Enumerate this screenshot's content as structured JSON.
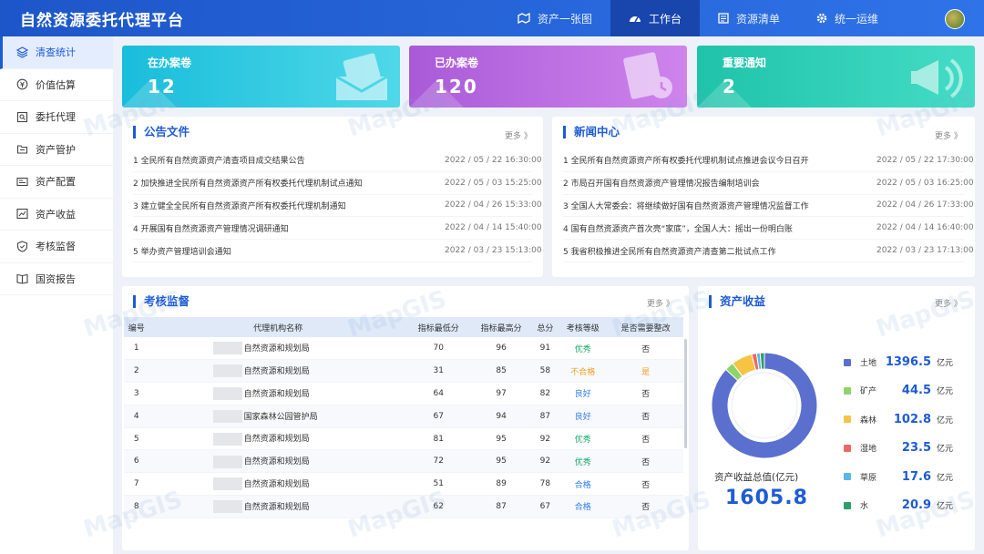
{
  "app": {
    "title": "自然资源委托代理平台"
  },
  "nav": [
    {
      "label": "资产一张图",
      "icon": "globe-map-icon"
    },
    {
      "label": "工作台",
      "icon": "dashboard-icon",
      "active": true
    },
    {
      "label": "资源清单",
      "icon": "list-icon"
    },
    {
      "label": "统一运维",
      "icon": "gear-icon"
    }
  ],
  "sidebar": [
    {
      "label": "清查统计",
      "icon": "layers-icon",
      "active": true
    },
    {
      "label": "价值估算",
      "icon": "coin-icon"
    },
    {
      "label": "委托代理",
      "icon": "document-search-icon"
    },
    {
      "label": "资产管护",
      "icon": "folder-icon"
    },
    {
      "label": "资产配置",
      "icon": "id-card-icon"
    },
    {
      "label": "资产收益",
      "icon": "line-chart-icon"
    },
    {
      "label": "考核监督",
      "icon": "shield-check-icon"
    },
    {
      "label": "国资报告",
      "icon": "book-icon"
    }
  ],
  "cards": [
    {
      "label": "在办案卷",
      "value": "12",
      "color": "#1cc2d9"
    },
    {
      "label": "已办案卷",
      "value": "120",
      "color": "#b86ddf"
    },
    {
      "label": "重要通知",
      "value": "2",
      "color": "#22c9b2"
    }
  ],
  "notices": {
    "title": "公告文件",
    "more": "更多 》",
    "items": [
      {
        "text": "1 全民所有自然资源资产清查项目成交结果公告",
        "date": "2022 / 05 / 22  16:30:00"
      },
      {
        "text": "2 加快推进全民所有自然资源资产所有权委托代理机制试点通知",
        "date": "2022 / 05 / 03  15:25:00"
      },
      {
        "text": "3 建立健全全民所有自然资源资产所有权委托代理机制通知",
        "date": "2022 / 04 / 26  15:33:00"
      },
      {
        "text": "4 开展国有自然资源资产管理情况调研通知",
        "date": "2022 / 04 / 14  15:40:00"
      },
      {
        "text": "5 举办资产管理培训会通知",
        "date": "2022 / 03 / 23  15:13:00"
      }
    ]
  },
  "news": {
    "title": "新闻中心",
    "more": "更多 》",
    "items": [
      {
        "text": "1 全民所有自然资源资产所有权委托代理机制试点推进会议今日召开",
        "date": "2022 / 05 / 22  17:30:00"
      },
      {
        "text": "2 市局召开国有自然资源资产管理情况报告编制培训会",
        "date": "2022 / 05 / 03  16:25:00"
      },
      {
        "text": "3 全国人大常委会：将继续做好国有自然资源资产管理情况监督工作",
        "date": "2022 / 04 / 26  17:33:00"
      },
      {
        "text": "4 国有自然资源资产首次亮“家底”，全国人大：摇出一份明白账",
        "date": "2022 / 04 / 14  16:40:00"
      },
      {
        "text": "5 我省积极推进全民所有自然资源资产清查第二批试点工作",
        "date": "2022 / 03 / 23  17:13:00"
      }
    ]
  },
  "audit": {
    "title": "考核监督",
    "more": "更多 》",
    "columns": [
      "编号",
      "代理机构名称",
      "指标最低分",
      "指标最高分",
      "总分",
      "考核等级",
      "是否需要整改"
    ],
    "rows": [
      {
        "no": "1",
        "name": "自然资源和规划局",
        "min": "70",
        "max": "96",
        "total": "91",
        "grade": "优秀",
        "fix": "否"
      },
      {
        "no": "2",
        "name": "自然资源和规划局",
        "min": "31",
        "max": "85",
        "total": "58",
        "grade": "不合格",
        "fix": "是"
      },
      {
        "no": "3",
        "name": "自然资源和规划局",
        "min": "64",
        "max": "97",
        "total": "82",
        "grade": "良好",
        "fix": "否"
      },
      {
        "no": "4",
        "name": "国家森林公园管护局",
        "min": "67",
        "max": "94",
        "total": "87",
        "grade": "良好",
        "fix": "否"
      },
      {
        "no": "5",
        "name": "自然资源和规划局",
        "min": "81",
        "max": "95",
        "total": "92",
        "grade": "优秀",
        "fix": "否"
      },
      {
        "no": "6",
        "name": "自然资源和规划局",
        "min": "72",
        "max": "95",
        "total": "92",
        "grade": "优秀",
        "fix": "否"
      },
      {
        "no": "7",
        "name": "自然资源和规划局",
        "min": "51",
        "max": "89",
        "total": "78",
        "grade": "合格",
        "fix": "否"
      },
      {
        "no": "8",
        "name": "自然资源和规划局",
        "min": "62",
        "max": "87",
        "total": "67",
        "grade": "合格",
        "fix": "否"
      }
    ],
    "grade_colors": {
      "优秀": "#19a96a",
      "不合格": "#f0a020",
      "良好": "#2d7ff0",
      "合格": "#2d7ff0"
    },
    "fix_colors": {
      "否": "#333333",
      "是": "#f0a020"
    }
  },
  "income": {
    "title": "资产收益",
    "more": "更多 》",
    "total_label": "资产收益总值(亿元)",
    "total_value": "1605.8",
    "unit": "亿元"
  },
  "chart_data": {
    "type": "pie",
    "title": "资产收益",
    "categories": [
      "土地",
      "矿产",
      "森林",
      "湿地",
      "草原",
      "水"
    ],
    "values": [
      1396.5,
      44.5,
      102.8,
      23.5,
      17.6,
      20.9
    ],
    "colors": [
      "#5b6fcf",
      "#8fd46b",
      "#f6c343",
      "#ef6666",
      "#5ab8e6",
      "#2f9e6b"
    ],
    "unit": "亿元"
  },
  "watermark": "MapGIS"
}
